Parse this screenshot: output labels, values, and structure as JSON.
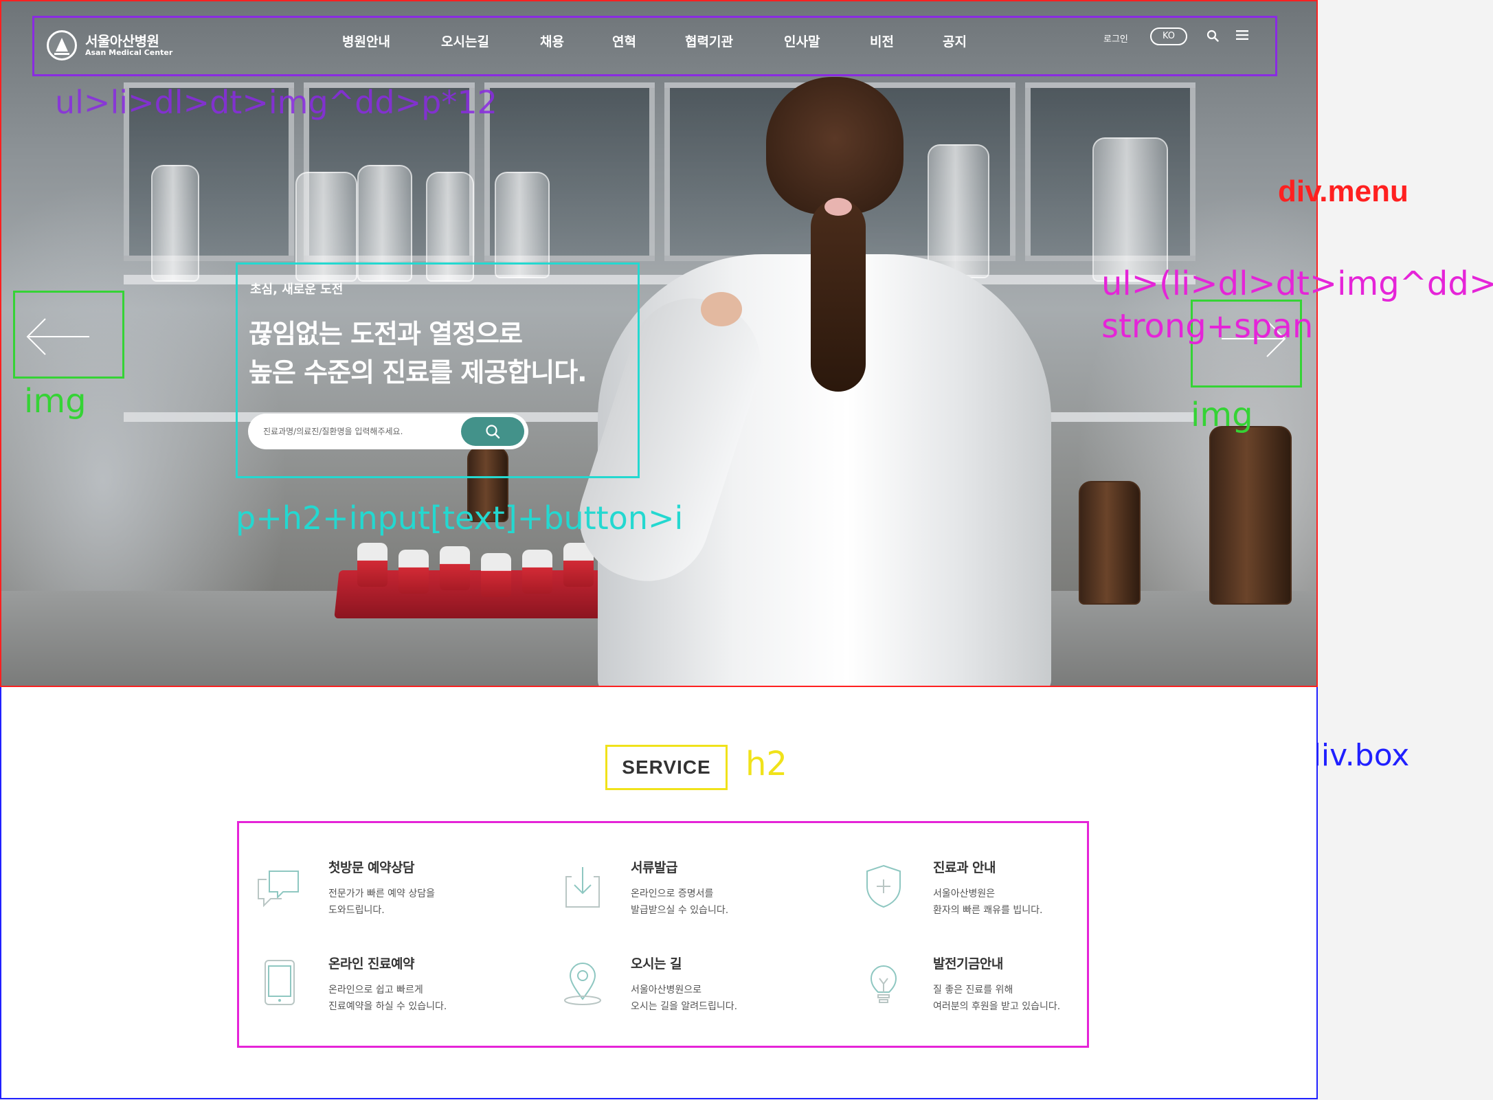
{
  "logo": {
    "name_ko": "서울아산병원",
    "name_en": "Asan Medical Center"
  },
  "nav": {
    "items": [
      "병원안내",
      "오시는길",
      "채용",
      "연혁",
      "협력기관",
      "인사말",
      "비전",
      "공지"
    ],
    "login": "로그인",
    "lang": "KO",
    "annotation": "ul>li>dl>dt>img^dd>p*12"
  },
  "hero": {
    "kicker": "초심, 새로운 도전",
    "title_line1": "끊임없는 도전과 열정으로",
    "title_line2": "높은 수준의 진료를 제공합니다.",
    "search_placeholder": "진료과명/의료진/질환명을 입력해주세요.",
    "annotation": "p+h2+input[text]+button>i"
  },
  "arrows": {
    "left_label": "img",
    "right_label": "img"
  },
  "labels": {
    "menu": "div.menu",
    "box": "div.box"
  },
  "service": {
    "title": "SERVICE",
    "title_annotation": "h2",
    "list_annotation_line1": "ul>(li>dl>dt>img^dd>p>",
    "list_annotation_line2": "strong+span",
    "items": [
      {
        "name": "첫방문 예약상담",
        "desc1": "전문가가 빠른 예약 상담을",
        "desc2": "도와드립니다.",
        "icon": "chat-icon"
      },
      {
        "name": "서류발급",
        "desc1": "온라인으로 증명서를",
        "desc2": "발급받으실 수 있습니다.",
        "icon": "download-icon"
      },
      {
        "name": "진료과 안내",
        "desc1": "서울아산병원은",
        "desc2": "환자의 빠른 쾌유를 빕니다.",
        "icon": "shield-icon"
      },
      {
        "name": "온라인 진료예약",
        "desc1": "온라인으로 쉽고 빠르게",
        "desc2": "진료예약을 하실 수 있습니다.",
        "icon": "tablet-icon"
      },
      {
        "name": "오시는 길",
        "desc1": "서울아산병원으로",
        "desc2": "오시는 길을 알려드립니다.",
        "icon": "location-icon"
      },
      {
        "name": "발전기금안내",
        "desc1": "질 좋은 진료를 위해",
        "desc2": "여러분의 후원을 받고 있습니다.",
        "icon": "lightbulb-icon"
      }
    ]
  },
  "colors": {
    "accent": "#43928a",
    "icon_line": "#8ec7c1"
  }
}
